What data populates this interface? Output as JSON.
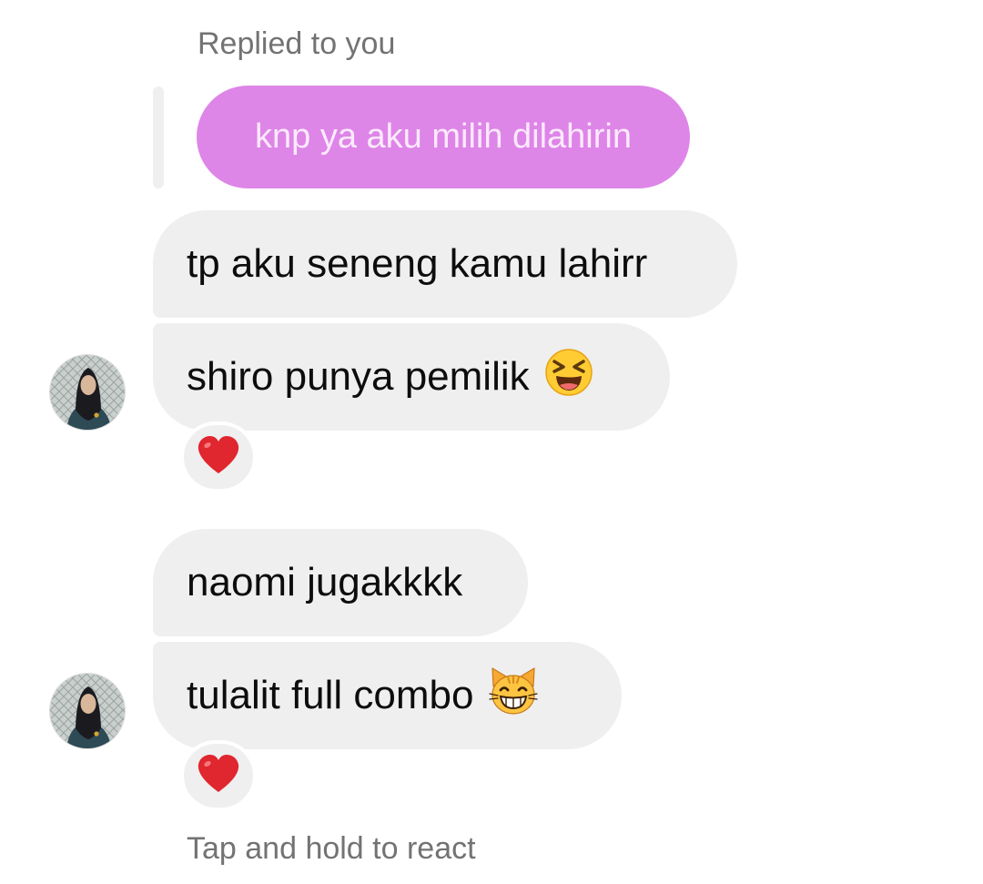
{
  "reply_header": "Replied to you",
  "quoted_message": "knp ya aku milih dilahirin",
  "messages": [
    {
      "text": "tp aku seneng kamu lahirr"
    },
    {
      "text": "shiro punya pemilik",
      "emoji": "laughing-squinting-face-icon",
      "reaction": "red-heart-icon"
    },
    {
      "text": "naomi jugakkkk"
    },
    {
      "text": "tulalit full combo",
      "emoji": "grinning-cat-icon",
      "reaction": "red-heart-icon"
    }
  ],
  "hint": "Tap and hold to react",
  "colors": {
    "quoted_bubble": "#de85e8",
    "bubble": "#efefef",
    "secondary_text": "#737373",
    "heart": "#e0262e"
  }
}
